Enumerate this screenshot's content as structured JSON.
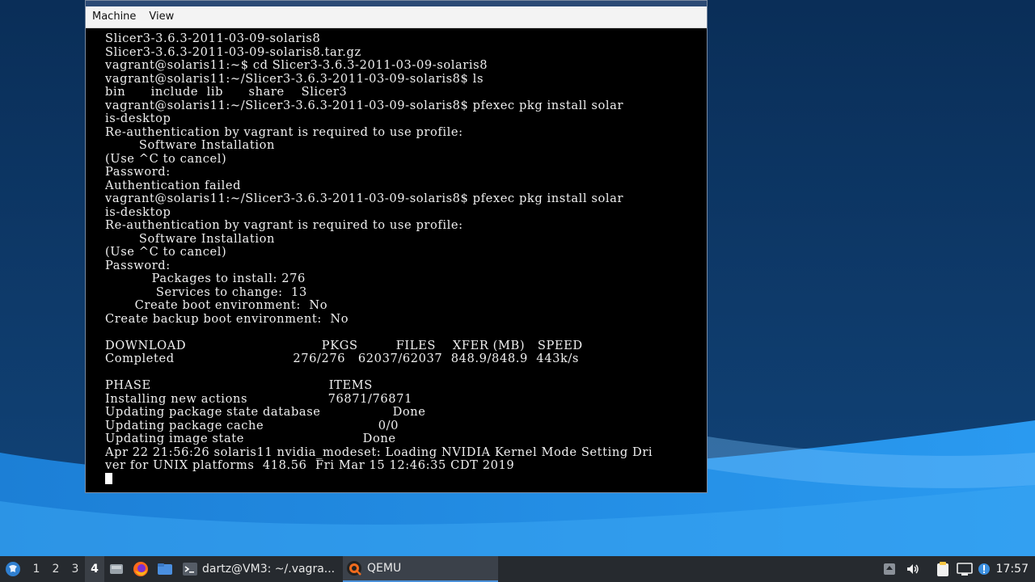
{
  "qemu": {
    "menu": [
      "Machine",
      "View"
    ],
    "terminal_lines": [
      "Slicer3-3.6.3-2011-03-09-solaris8",
      "Slicer3-3.6.3-2011-03-09-solaris8.tar.gz",
      "vagrant@solaris11:~$ cd Slicer3-3.6.3-2011-03-09-solaris8",
      "vagrant@solaris11:~/Slicer3-3.6.3-2011-03-09-solaris8$ ls",
      "bin      include  lib      share    Slicer3",
      "vagrant@solaris11:~/Slicer3-3.6.3-2011-03-09-solaris8$ pfexec pkg install solar",
      "is-desktop",
      "Re-authentication by vagrant is required to use profile:",
      "        Software Installation",
      "(Use ^C to cancel)",
      "Password:",
      "Authentication failed",
      "vagrant@solaris11:~/Slicer3-3.6.3-2011-03-09-solaris8$ pfexec pkg install solar",
      "is-desktop",
      "Re-authentication by vagrant is required to use profile:",
      "        Software Installation",
      "(Use ^C to cancel)",
      "Password:",
      "           Packages to install: 276",
      "            Services to change:  13",
      "       Create boot environment:  No",
      "Create backup boot environment:  No",
      "",
      "DOWNLOAD                                PKGS         FILES    XFER (MB)   SPEED",
      "Completed                            276/276   62037/62037  848.9/848.9  443k/s",
      "",
      "PHASE                                          ITEMS",
      "Installing new actions                   76871/76871",
      "Updating package state database                 Done",
      "Updating package cache                           0/0",
      "Updating image state                            Done",
      "Apr 22 21:56:26 solaris11 nvidia_modeset: Loading NVIDIA Kernel Mode Setting Dri",
      "ver for UNIX platforms  418.56  Fri Mar 15 12:46:35 CDT 2019"
    ]
  },
  "taskbar": {
    "workspaces": [
      "1",
      "2",
      "3",
      "4"
    ],
    "active_workspace": "4",
    "tasks": [
      {
        "label": "dartz@VM3: ~/.vagra...",
        "icon": "terminal-icon"
      },
      {
        "label": "QEMU",
        "icon": "qemu-icon"
      }
    ],
    "launchers": [
      "file-manager-icon",
      "firefox-icon",
      "folder-icon"
    ],
    "tray": [
      "updates-icon",
      "volume-icon",
      "clipboard-icon",
      "network-icon",
      "notification-icon"
    ],
    "clock": "17:57"
  },
  "colors": {
    "accent": "#4a90d9",
    "taskbar_bg": "#262a2f",
    "wallpaper_dark": "#0d3766",
    "wallpaper_light": "#1e88e0"
  }
}
